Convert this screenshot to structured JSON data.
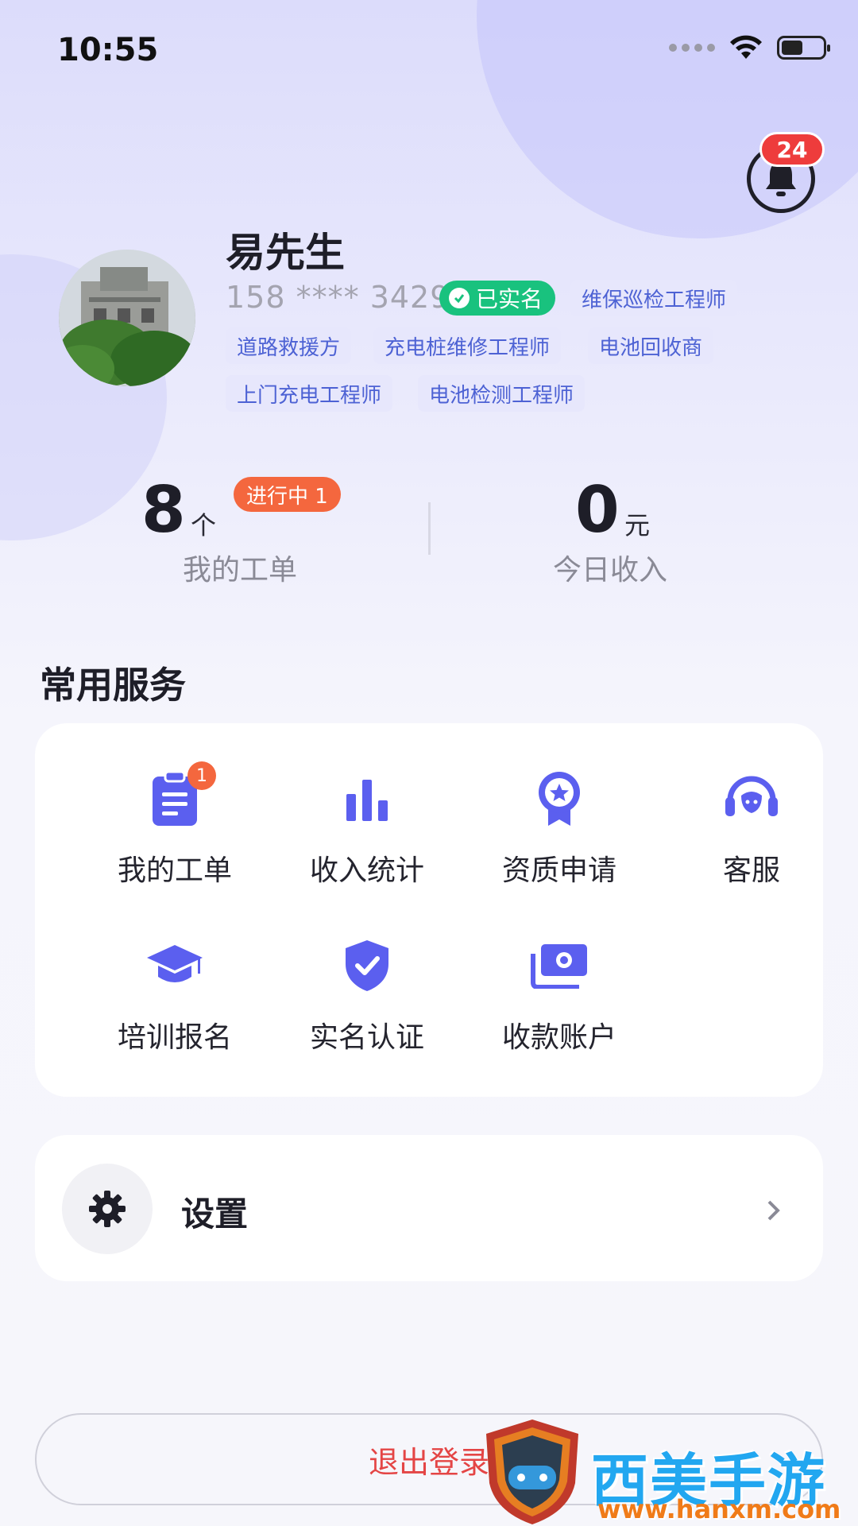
{
  "status_bar": {
    "time": "10:55"
  },
  "notifications": {
    "count": "24"
  },
  "profile": {
    "name": "易先生",
    "phone": "158 **** 3429",
    "verified_label": "已实名",
    "roles": [
      "维保巡检工程师",
      "道路救援方",
      "充电桩维修工程师",
      "电池回收商",
      "上门充电工程师",
      "电池检测工程师"
    ]
  },
  "stats": {
    "orders": {
      "value": "8",
      "unit": "个",
      "label": "我的工单",
      "badge": "进行中 1"
    },
    "income": {
      "value": "0",
      "unit": "元",
      "label": "今日收入"
    }
  },
  "services": {
    "title": "常用服务",
    "items": [
      {
        "label": "我的工单",
        "icon": "clipboard-icon",
        "badge": "1"
      },
      {
        "label": "收入统计",
        "icon": "bar-chart-icon"
      },
      {
        "label": "资质申请",
        "icon": "award-medal-icon"
      },
      {
        "label": "客服",
        "icon": "headset-icon"
      },
      {
        "label": "培训报名",
        "icon": "graduation-cap-icon"
      },
      {
        "label": "实名认证",
        "icon": "shield-check-icon"
      },
      {
        "label": "收款账户",
        "icon": "money-cash-icon"
      }
    ]
  },
  "settings": {
    "label": "设置",
    "icon": "gear-icon"
  },
  "logout": {
    "label": "退出登录"
  },
  "watermark": {
    "text": "西美手游网",
    "url": "www.hanxm.com"
  },
  "colors": {
    "accent": "#5b5fef",
    "badge_red": "#ee3c3c",
    "badge_orange": "#f4673e",
    "verified_green": "#19c27e",
    "role_text": "#4d62d4",
    "logout_red": "#e44545"
  }
}
